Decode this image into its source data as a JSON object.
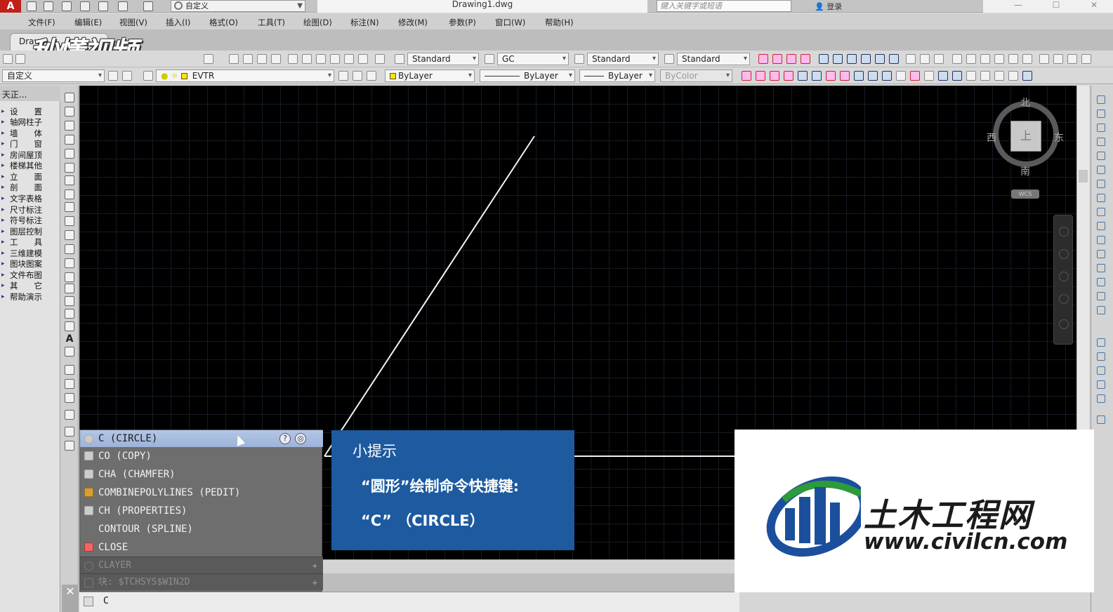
{
  "titlebar": {
    "workspace": "自定义",
    "title": "Drawing1.dwg",
    "search_placeholder": "键入关键字或短语",
    "login": "登录"
  },
  "menu": [
    "文件(F)",
    "编辑(E)",
    "视图(V)",
    "插入(I)",
    "格式(O)",
    "工具(T)",
    "绘图(D)",
    "标注(N)",
    "修改(M)",
    "参数(P)",
    "窗口(W)",
    "帮助(H)"
  ],
  "tab": {
    "label": "Draw"
  },
  "watermark_left": "秒懂视频",
  "toolbar1": {
    "text_style": "Standard",
    "dim_style": "GC",
    "table_style": "Standard",
    "mleader_style": "Standard"
  },
  "toolbar2": {
    "workspace": "自定义",
    "layer": "EVTR",
    "color": "ByLayer",
    "linetype": "ByLayer",
    "lineweight": "ByLayer",
    "plotstyle": "ByColor"
  },
  "tz_panel": {
    "header": "天正...",
    "items": [
      "设　　置",
      "轴网柱子",
      "墙　　体",
      "门　　窗",
      "房间屋顶",
      "楼梯其他",
      "立　　面",
      "剖　　面",
      "文字表格",
      "尺寸标注",
      "符号标注",
      "图层控制",
      "工　　具",
      "三维建模",
      "图块图案",
      "文件布图",
      "其　　它",
      "帮助演示"
    ]
  },
  "viewcube": {
    "north": "北",
    "south": "南",
    "east": "东",
    "west": "西",
    "face": "上",
    "wcs": "WCS"
  },
  "autocomplete": {
    "items": [
      {
        "label": "C (CIRCLE)",
        "selected": true
      },
      {
        "label": "CO (COPY)"
      },
      {
        "label": "CHA (CHAMFER)"
      },
      {
        "label": "COMBINEPOLYLINES (PEDIT)"
      },
      {
        "label": "CH (PROPERTIES)"
      },
      {
        "label": "CONTOUR (SPLINE)"
      },
      {
        "label": "CLOSE"
      }
    ],
    "sysvar": "CLAYER",
    "block": "块: $TCHSYS$WIN2D",
    "help_icon": "?"
  },
  "command_line": {
    "prompt": "C"
  },
  "tip": {
    "title": "小提示",
    "line1": "“圆形”绘制命令快捷键:",
    "line2": "“C” （CIRCLE）"
  },
  "civil_logo": {
    "name": "土木工程网",
    "url": "www.civilcn.com"
  },
  "colors": {
    "canvas": "#000000",
    "tip_bg": "#1d5aa0",
    "ac_selected": "#b2c6e6",
    "logo_blue": "#1b4f9c",
    "logo_green": "#2e9a3c"
  }
}
